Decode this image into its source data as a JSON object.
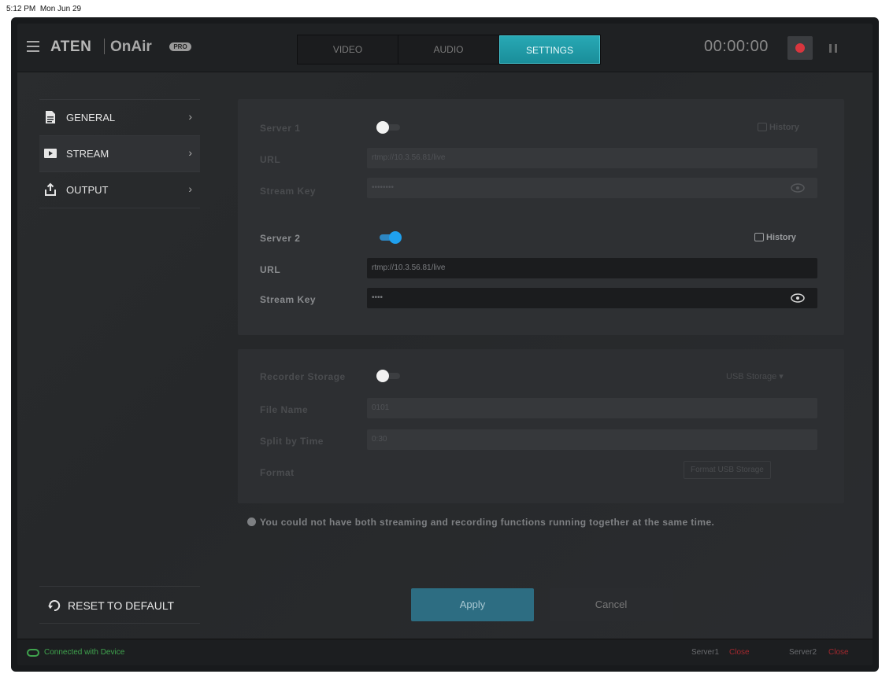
{
  "status_bar": {
    "time": "5:12 PM",
    "date": "Mon Jun 29"
  },
  "header": {
    "brand": "ATEN",
    "product": "OnAir",
    "badge": "PRO",
    "tabs": [
      {
        "label": "VIDEO",
        "active": false
      },
      {
        "label": "AUDIO",
        "active": false
      },
      {
        "label": "SETTINGS",
        "active": true
      }
    ],
    "timer": "00:00:00"
  },
  "sidebar": {
    "items": [
      {
        "label": "GENERAL",
        "icon": "document-icon",
        "selected": false
      },
      {
        "label": "STREAM",
        "icon": "play-icon",
        "selected": true
      },
      {
        "label": "OUTPUT",
        "icon": "export-icon",
        "selected": false
      }
    ],
    "reset_label": "RESET TO DEFAULT"
  },
  "stream": {
    "server1": {
      "label": "Server 1",
      "enabled": false,
      "url_label": "URL",
      "url": "rtmp://10.3.56.81/live",
      "key_label": "Stream Key",
      "key": "••••••••",
      "history": "History"
    },
    "server2": {
      "label": "Server 2",
      "enabled": true,
      "url_label": "URL",
      "url": "rtmp://10.3.56.81/live",
      "key_label": "Stream Key",
      "key": "••••",
      "history": "History"
    },
    "recording": {
      "toggle_label": "Recorder Storage",
      "enabled": false,
      "storage": "USB Storage",
      "file_name_label": "File Name",
      "file_name": "0101",
      "split_label": "Split by Time",
      "split": "0:30",
      "format_label": "Format",
      "format_button": "Format USB Storage"
    },
    "notice": "You could not have both streaming and recording functions running together at the same time."
  },
  "actions": {
    "apply": "Apply",
    "cancel": "Cancel"
  },
  "footer": {
    "connection": "Connected with Device",
    "server1_label": "Server1",
    "server1_status": "Close",
    "server2_label": "Server2",
    "server2_status": "Close"
  },
  "colors": {
    "accent": "#1fa0ee",
    "active_tab": "#1a8e9a",
    "record": "#d9363e",
    "connected": "#3fa34d"
  }
}
